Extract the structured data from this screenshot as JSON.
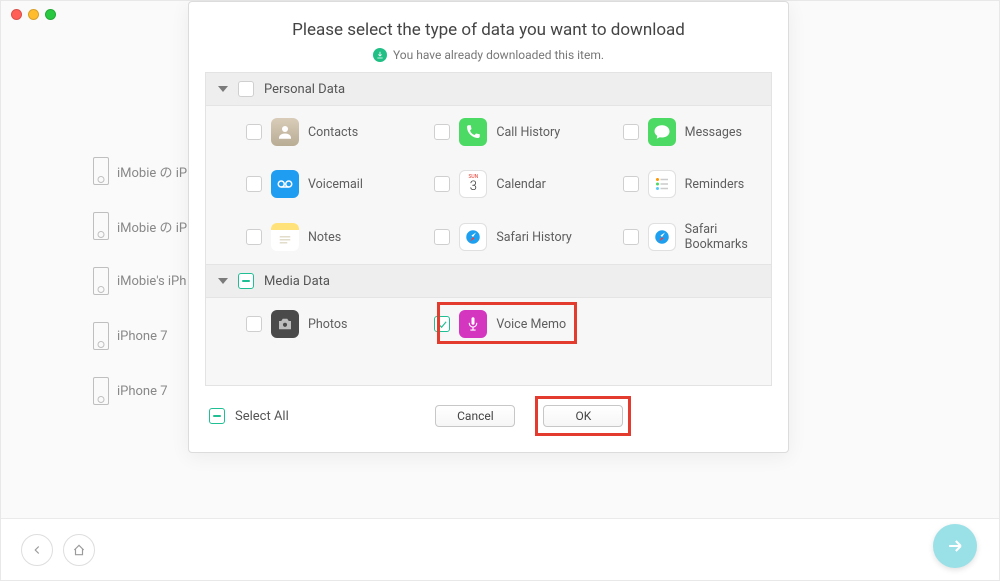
{
  "devices": [
    "iMobie の iP",
    "iMobie の iP",
    "iMobie's iPh",
    "iPhone 7",
    "iPhone 7"
  ],
  "modal": {
    "title": "Please select the type of data you want to download",
    "already": "You have already downloaded this item.",
    "sections": {
      "personal": {
        "title": "Personal Data",
        "items": [
          "Contacts",
          "Call History",
          "Messages",
          "Voicemail",
          "Calendar",
          "Reminders",
          "Notes",
          "Safari History",
          "Safari Bookmarks"
        ]
      },
      "media": {
        "title": "Media Data",
        "items": [
          "Photos",
          "Voice Memo"
        ]
      }
    },
    "select_all": "Select All",
    "cancel": "Cancel",
    "ok": "OK"
  },
  "selected": {
    "voice_memo": true
  },
  "icon_colors": {
    "contacts": "#c0b7a8",
    "call_history": "#4cd964",
    "messages": "#4cd964",
    "voicemail": "#1f9df1",
    "calendar": "#ffffff",
    "reminders": "#ffffff",
    "notes": "#ffd34e",
    "safari_history": "#1ea0f1",
    "safari_bookmarks": "#1ea0f1",
    "photos": "#4a4a4a",
    "voice_memo": "#d436c0"
  }
}
